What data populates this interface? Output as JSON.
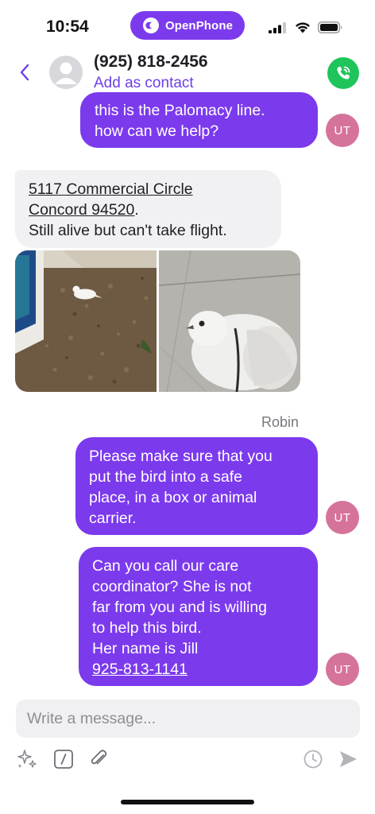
{
  "status_bar": {
    "time": "10:54",
    "brand": "OpenPhone",
    "icons": [
      "cellular-signal-icon",
      "wifi-icon",
      "battery-icon"
    ]
  },
  "header": {
    "back_icon": "chevron-left-icon",
    "contact_number": "(925) 818-2456",
    "add_contact_label": "Add as contact",
    "call_icon": "phone-call-icon"
  },
  "colors": {
    "accent": "#7c3aed",
    "incoming_bubble": "#f1f1f3",
    "avatar": "#d6739a",
    "call_button": "#1fc45b"
  },
  "messages": [
    {
      "direction": "outgoing",
      "lines": [
        "this is the Palomacy line.",
        "how can we help?"
      ],
      "avatar": "UT"
    },
    {
      "direction": "incoming",
      "address_line1": "5117 Commercial Circle",
      "address_line2": "Concord 94520",
      "address_suffix": ".",
      "text": "Still alive but can't take flight."
    },
    {
      "direction": "incoming",
      "attachments": [
        "pigeon-on-mulch-photo",
        "pigeon-closeup-photo"
      ]
    },
    {
      "direction": "outgoing",
      "sender": "Robin",
      "lines": [
        "Please make sure that you",
        "put the bird into a safe",
        "place, in a box or animal",
        "carrier."
      ],
      "avatar": "UT"
    },
    {
      "direction": "outgoing",
      "lines": [
        "Can you call our care",
        "coordinator?  She is not",
        "far from you and is willing",
        "to help this bird.",
        "Her name is Jill"
      ],
      "phone_link": "925-813-1141",
      "avatar": "UT"
    }
  ],
  "composer": {
    "placeholder": "Write a message...",
    "tools": [
      "sparkle-icon",
      "snippet-icon",
      "paperclip-icon"
    ],
    "schedule_icon": "clock-icon",
    "send_icon": "send-icon"
  }
}
